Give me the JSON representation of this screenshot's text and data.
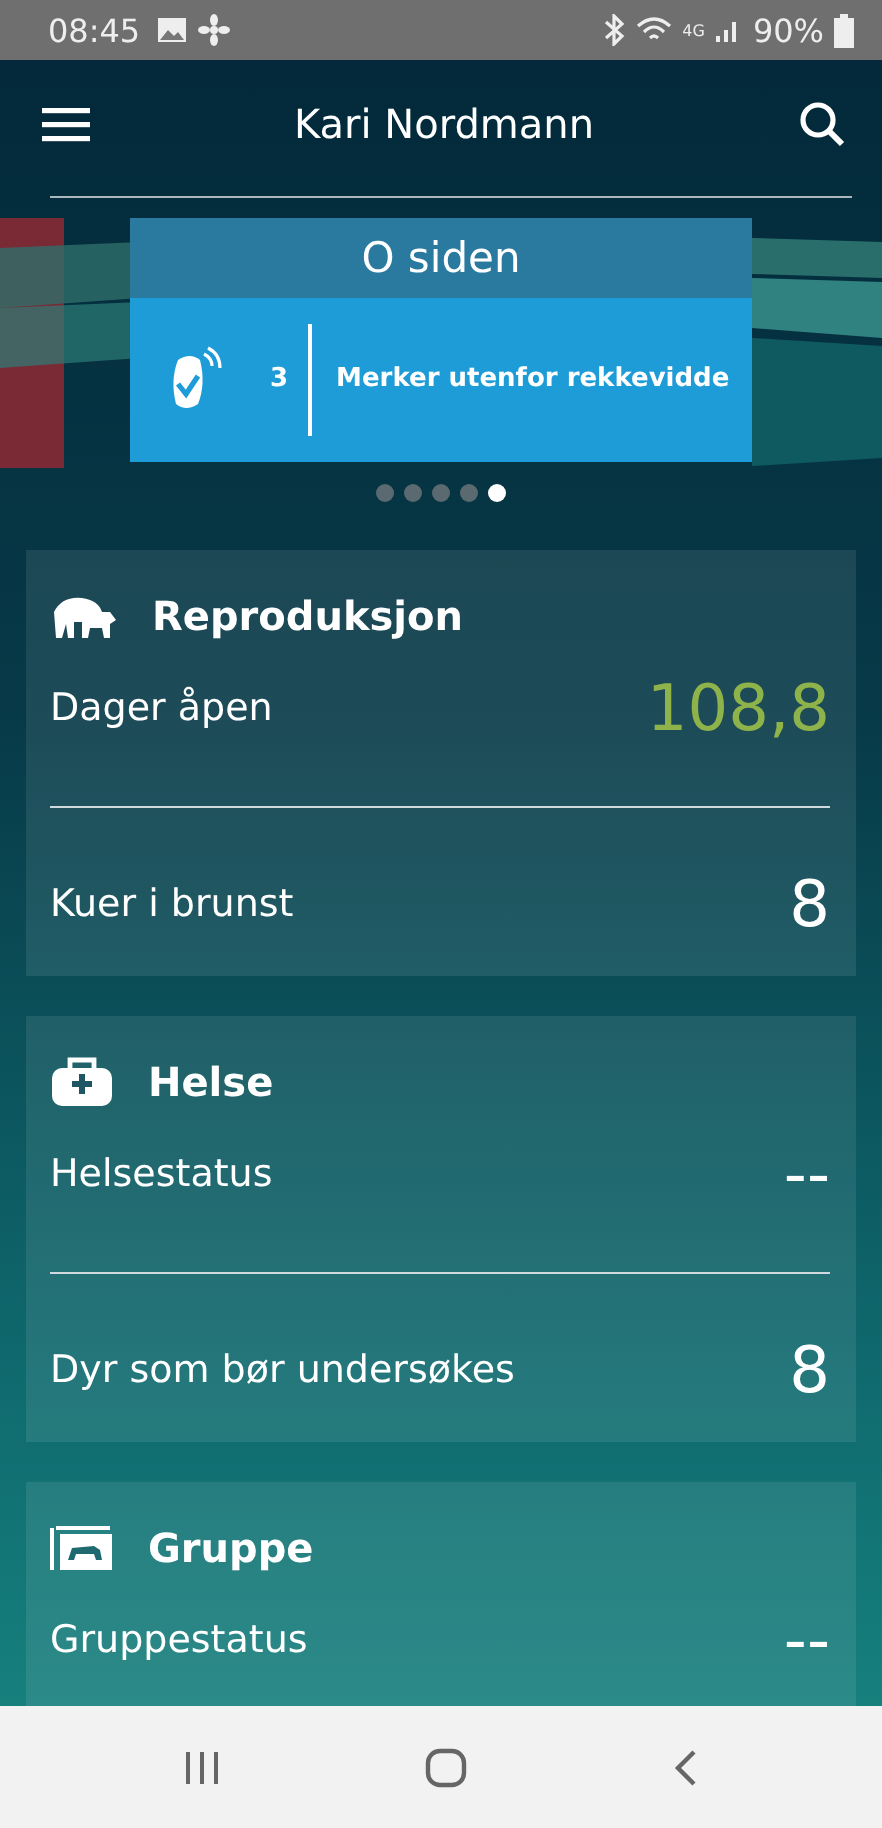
{
  "status_bar": {
    "time": "08:45",
    "network": "4G",
    "battery": "90%"
  },
  "header": {
    "title": "Kari Nordmann"
  },
  "banner": {
    "title": "O siden",
    "count": "3",
    "label": "Merker utenfor rekkevidde"
  },
  "carousel_dots": [
    {
      "selected": false
    },
    {
      "selected": false
    },
    {
      "selected": false
    },
    {
      "selected": false
    },
    {
      "selected": true
    }
  ],
  "cards": [
    {
      "kind": "reproduction",
      "title": "Reproduksjon",
      "rows": [
        {
          "label": "Dager åpen",
          "value": "108,8",
          "highlighted": true
        },
        {
          "label": "Kuer i brunst",
          "value": "8",
          "highlighted": false
        }
      ]
    },
    {
      "kind": "health",
      "title": "Helse",
      "rows": [
        {
          "label": "Helsestatus",
          "value": "--",
          "highlighted": false
        },
        {
          "label": "Dyr som bør undersøkes",
          "value": "8",
          "highlighted": false
        }
      ]
    },
    {
      "kind": "group",
      "title": "Gruppe",
      "rows": [
        {
          "label": "Gruppestatus",
          "value": "--",
          "highlighted": false
        }
      ]
    }
  ]
}
